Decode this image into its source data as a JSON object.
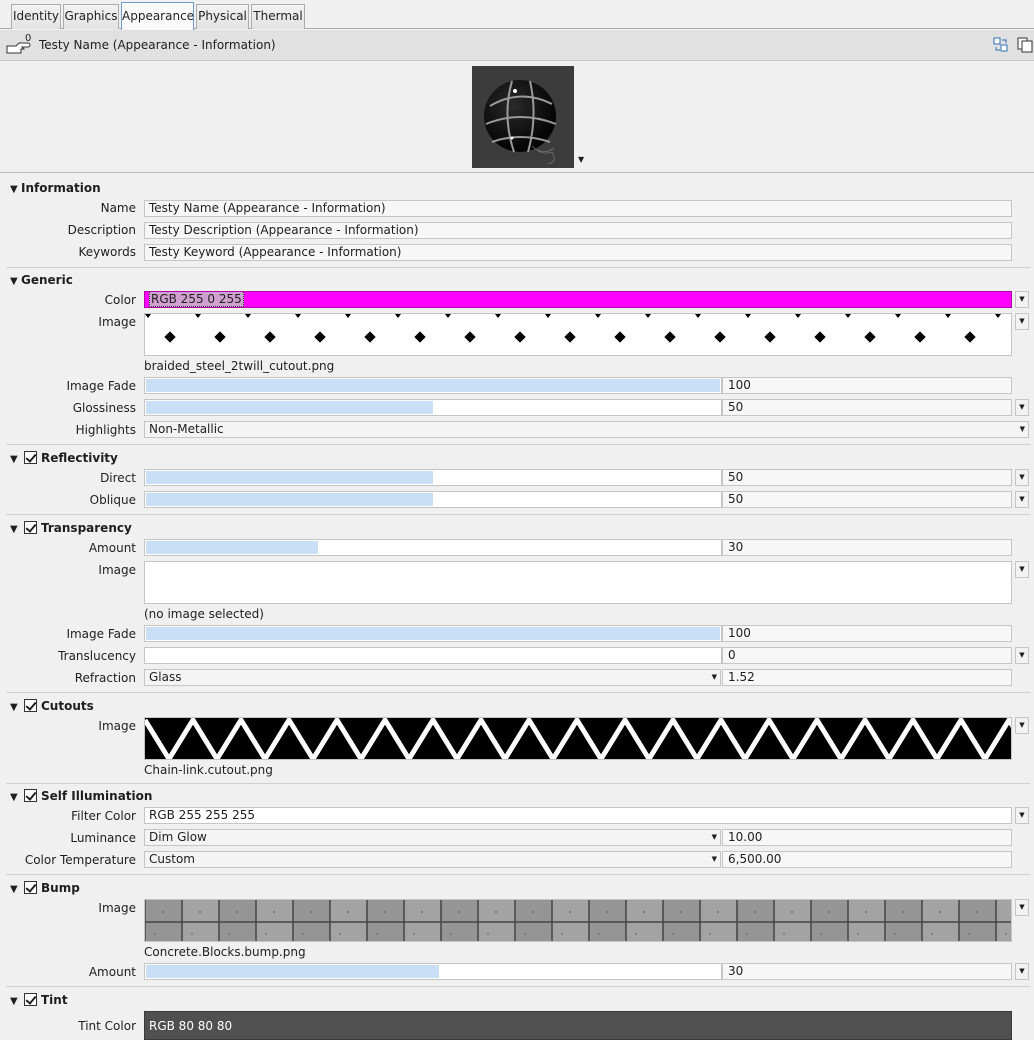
{
  "tabs": [
    "Identity",
    "Graphics",
    "Appearance",
    "Physical",
    "Thermal"
  ],
  "active_tab": "Appearance",
  "title": "Testy Name (Appearance - Information)",
  "badge_count": "0",
  "sections": {
    "information": {
      "heading": "Information",
      "name_label": "Name",
      "name_value": "Testy Name (Appearance - Information)",
      "description_label": "Description",
      "description_value": "Testy Description (Appearance - Information)",
      "keywords_label": "Keywords",
      "keywords_value": "Testy Keyword (Appearance - Information)"
    },
    "generic": {
      "heading": "Generic",
      "color_label": "Color",
      "color_value": "RGB 255 0 255",
      "color_hex": "#ff00ff",
      "image_label": "Image",
      "image_file": "braided_steel_2twill_cutout.png",
      "image_fade_label": "Image Fade",
      "image_fade_value": "100",
      "image_fade_level": 100,
      "glossiness_label": "Glossiness",
      "glossiness_value": "50",
      "glossiness_level": 50,
      "highlights_label": "Highlights",
      "highlights_value": "Non-Metallic"
    },
    "reflectivity": {
      "heading": "Reflectivity",
      "checked": true,
      "direct_label": "Direct",
      "direct_value": "50",
      "direct_level": 50,
      "oblique_label": "Oblique",
      "oblique_value": "50",
      "oblique_level": 50
    },
    "transparency": {
      "heading": "Transparency",
      "checked": true,
      "amount_label": "Amount",
      "amount_value": "30",
      "amount_level": 30,
      "image_label": "Image",
      "image_file": "(no image selected)",
      "image_fade_label": "Image Fade",
      "image_fade_value": "100",
      "image_fade_level": 100,
      "translucency_label": "Translucency",
      "translucency_value": "0",
      "translucency_level": 0,
      "refraction_label": "Refraction",
      "refraction_value": "Glass",
      "refraction_number": "1.52"
    },
    "cutouts": {
      "heading": "Cutouts",
      "checked": true,
      "image_label": "Image",
      "image_file": "Chain-link.cutout.png"
    },
    "self_illumination": {
      "heading": "Self Illumination",
      "checked": true,
      "filter_color_label": "Filter Color",
      "filter_color_value": "RGB 255 255 255",
      "luminance_label": "Luminance",
      "luminance_value": "Dim Glow",
      "luminance_number": "10.00",
      "color_temp_label": "Color Temperature",
      "color_temp_value": "Custom",
      "color_temp_number": "6,500.00"
    },
    "bump": {
      "heading": "Bump",
      "checked": true,
      "image_label": "Image",
      "image_file": "Concrete.Blocks.bump.png",
      "amount_label": "Amount",
      "amount_value": "30",
      "amount_level": 30
    },
    "tint": {
      "heading": "Tint",
      "checked": true,
      "tint_color_label": "Tint Color",
      "tint_color_value": "RGB 80 80 80",
      "tint_hex": "#505050"
    }
  },
  "colors": {
    "slider_fill": "#c8dff5",
    "accent": "#6e9bd2"
  },
  "icons": [
    "hand-pointer-icon",
    "swap-icon",
    "copy-icon",
    "collapse-triangle-icon",
    "dropdown-arrow-icon"
  ]
}
